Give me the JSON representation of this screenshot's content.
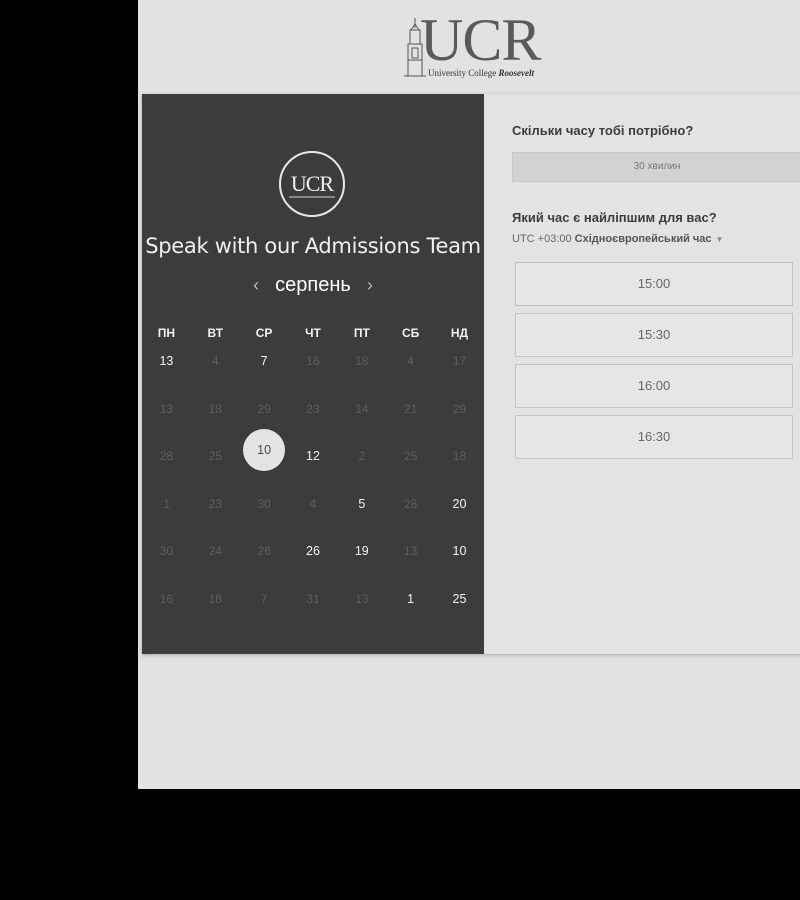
{
  "logo": {
    "main": "UCR",
    "sub_plain": "University College ",
    "sub_emph": "Roosevelt"
  },
  "scheduler": {
    "circle_logo_text": "UCR",
    "title": "Speak with our Admissions Team",
    "month": "серпень",
    "prev_icon": "chevron-left-icon",
    "next_icon": "chevron-right-icon",
    "weekdays": [
      "ПН",
      "ВТ",
      "СР",
      "ЧТ",
      "ПТ",
      "СБ",
      "НД"
    ],
    "weeks": [
      [
        "13",
        "4",
        "7",
        "16",
        "18",
        "4",
        "17"
      ],
      [
        "13",
        "18",
        "29",
        "23",
        "14",
        "21",
        "29"
      ],
      [
        "28",
        "25",
        "10",
        "12",
        "2",
        "25",
        "18"
      ],
      [
        "1",
        "23",
        "30",
        "4",
        "5",
        "28",
        "20"
      ],
      [
        "30",
        "24",
        "26",
        "26",
        "19",
        "13",
        "10"
      ],
      [
        "16",
        "18",
        "7",
        "31",
        "13",
        "1",
        "25"
      ]
    ],
    "active": [
      [
        true,
        false,
        true,
        false,
        false,
        false,
        false
      ],
      [
        false,
        false,
        false,
        false,
        false,
        false,
        false
      ],
      [
        false,
        false,
        true,
        true,
        false,
        false,
        false
      ],
      [
        false,
        false,
        false,
        false,
        true,
        false,
        true
      ],
      [
        false,
        false,
        false,
        true,
        true,
        false,
        true
      ],
      [
        false,
        false,
        false,
        false,
        false,
        true,
        true
      ]
    ],
    "selected_day": "10"
  },
  "booking": {
    "duration_question": "Скільки часу тобі потрібно?",
    "duration_value": "30 хвилин",
    "time_question": "Який час є найліпшим для вас?",
    "timezone_prefix": "UTC +03:00 ",
    "timezone_name": "Східноєвропейський час",
    "timezone_caret_icon": "caret-down-icon",
    "slots": [
      "15:00",
      "15:30",
      "16:00",
      "16:30"
    ]
  },
  "colors": {
    "panel_dark": "#3c3c3c",
    "page_bg": "#e2e2e2",
    "selected_day_bg": "#e4e4e4"
  }
}
